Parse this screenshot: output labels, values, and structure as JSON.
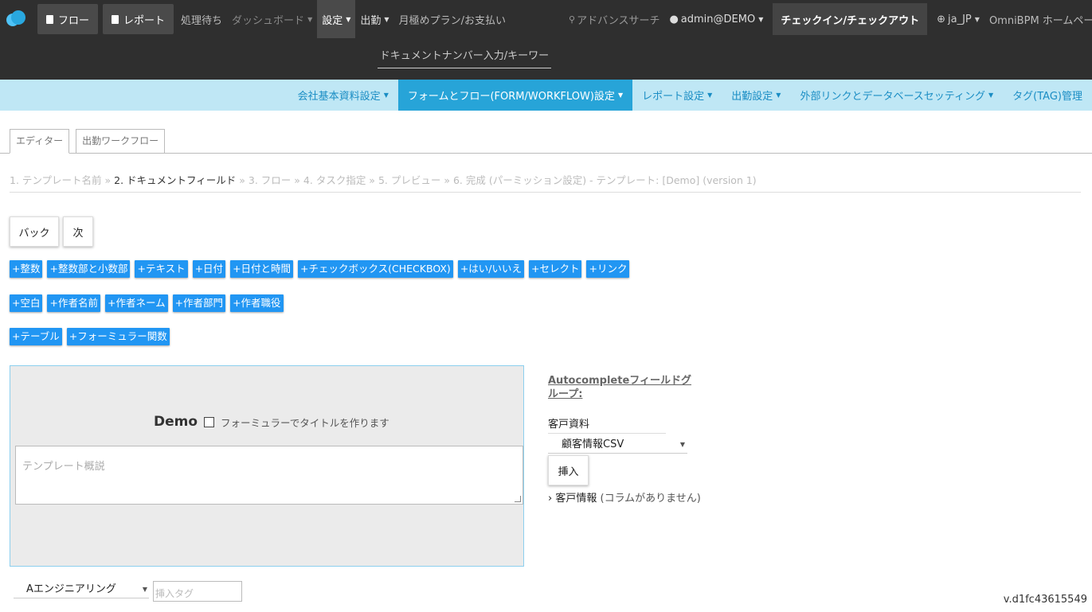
{
  "header": {
    "nav_left": [
      {
        "label": "フロー",
        "kind": "button"
      },
      {
        "label": "レポート",
        "kind": "button"
      },
      {
        "label": "処理待ち",
        "kind": "link"
      },
      {
        "label": "ダッシュボード",
        "kind": "dropdown-dim"
      },
      {
        "label": "設定",
        "kind": "dropdown-active"
      },
      {
        "label": "出勤",
        "kind": "dropdown"
      },
      {
        "label": "月極めプラン/お支払い",
        "kind": "link"
      }
    ],
    "advanced_search": "アドバンスサーチ",
    "user": "admin@DEMO",
    "checkin": "チェックイン/チェックアウト",
    "language": "ja_JP",
    "home": "OmniBPM ホームページ",
    "doc_search_placeholder": "ドキュメントナンバー入力/キーワー"
  },
  "subnav": [
    {
      "label": "会社基本資料設定",
      "active": false
    },
    {
      "label": "フォームとフロー(FORM/WORKFLOW)設定",
      "active": true
    },
    {
      "label": "レポート設定",
      "active": false
    },
    {
      "label": "出勤設定",
      "active": false
    },
    {
      "label": "外部リンクとデータベースセッティング",
      "active": false
    },
    {
      "label": "タグ(TAG)管理",
      "active": false
    }
  ],
  "tabs": {
    "editor": "エディター",
    "workflow": "出勤ワークフロー"
  },
  "steps": {
    "s1": "1. テンプレート名前",
    "s2": "2. ドキュメントフィールド",
    "s3": "3. フロー",
    "s4": "4. タスク指定",
    "s5": "5. プレビュー",
    "s6": "6. 完成 (パーミッション設定) - テンプレート: [Demo] (version 1)",
    "sep": " » "
  },
  "buttons": {
    "back": "バック",
    "next": "次",
    "insert": "挿入"
  },
  "chips_row1": [
    "+整数",
    "+整数部と小数部",
    "+テキスト",
    "+日付",
    "+日付と時間",
    "+チェックボックス(CHECKBOX)",
    "+はい/いいえ",
    "+セレクト",
    "+リンク"
  ],
  "chips_row2": [
    "+空白",
    "+作者名前",
    "+作者ネーム",
    "+作者部門",
    "+作者職役"
  ],
  "chips_row3": [
    "+テーブル",
    "+フォーミュラー関数"
  ],
  "form": {
    "title": "Demo",
    "formula_title_label": "フォーミュラーでタイトルを作ります",
    "description_placeholder": "テンプレート概説"
  },
  "autocomplete": {
    "title": "Autocompleteフィールドグループ:",
    "group_label": "客戸資料",
    "selected_source": "顧客情報CSV",
    "expand_label": "客戸情報",
    "expand_note": "(コラムがありません)"
  },
  "footer": {
    "tag_select": "Aエンジニアリング",
    "tag_input_placeholder": "挿入タグ",
    "version": "v.d1fc43615549"
  },
  "colors": {
    "topbar": "#2f2f2f",
    "subnav": "#bfe7f5",
    "subnav_active": "#27a4d8",
    "chip": "#2196f3",
    "form_border": "#8ccfee"
  }
}
